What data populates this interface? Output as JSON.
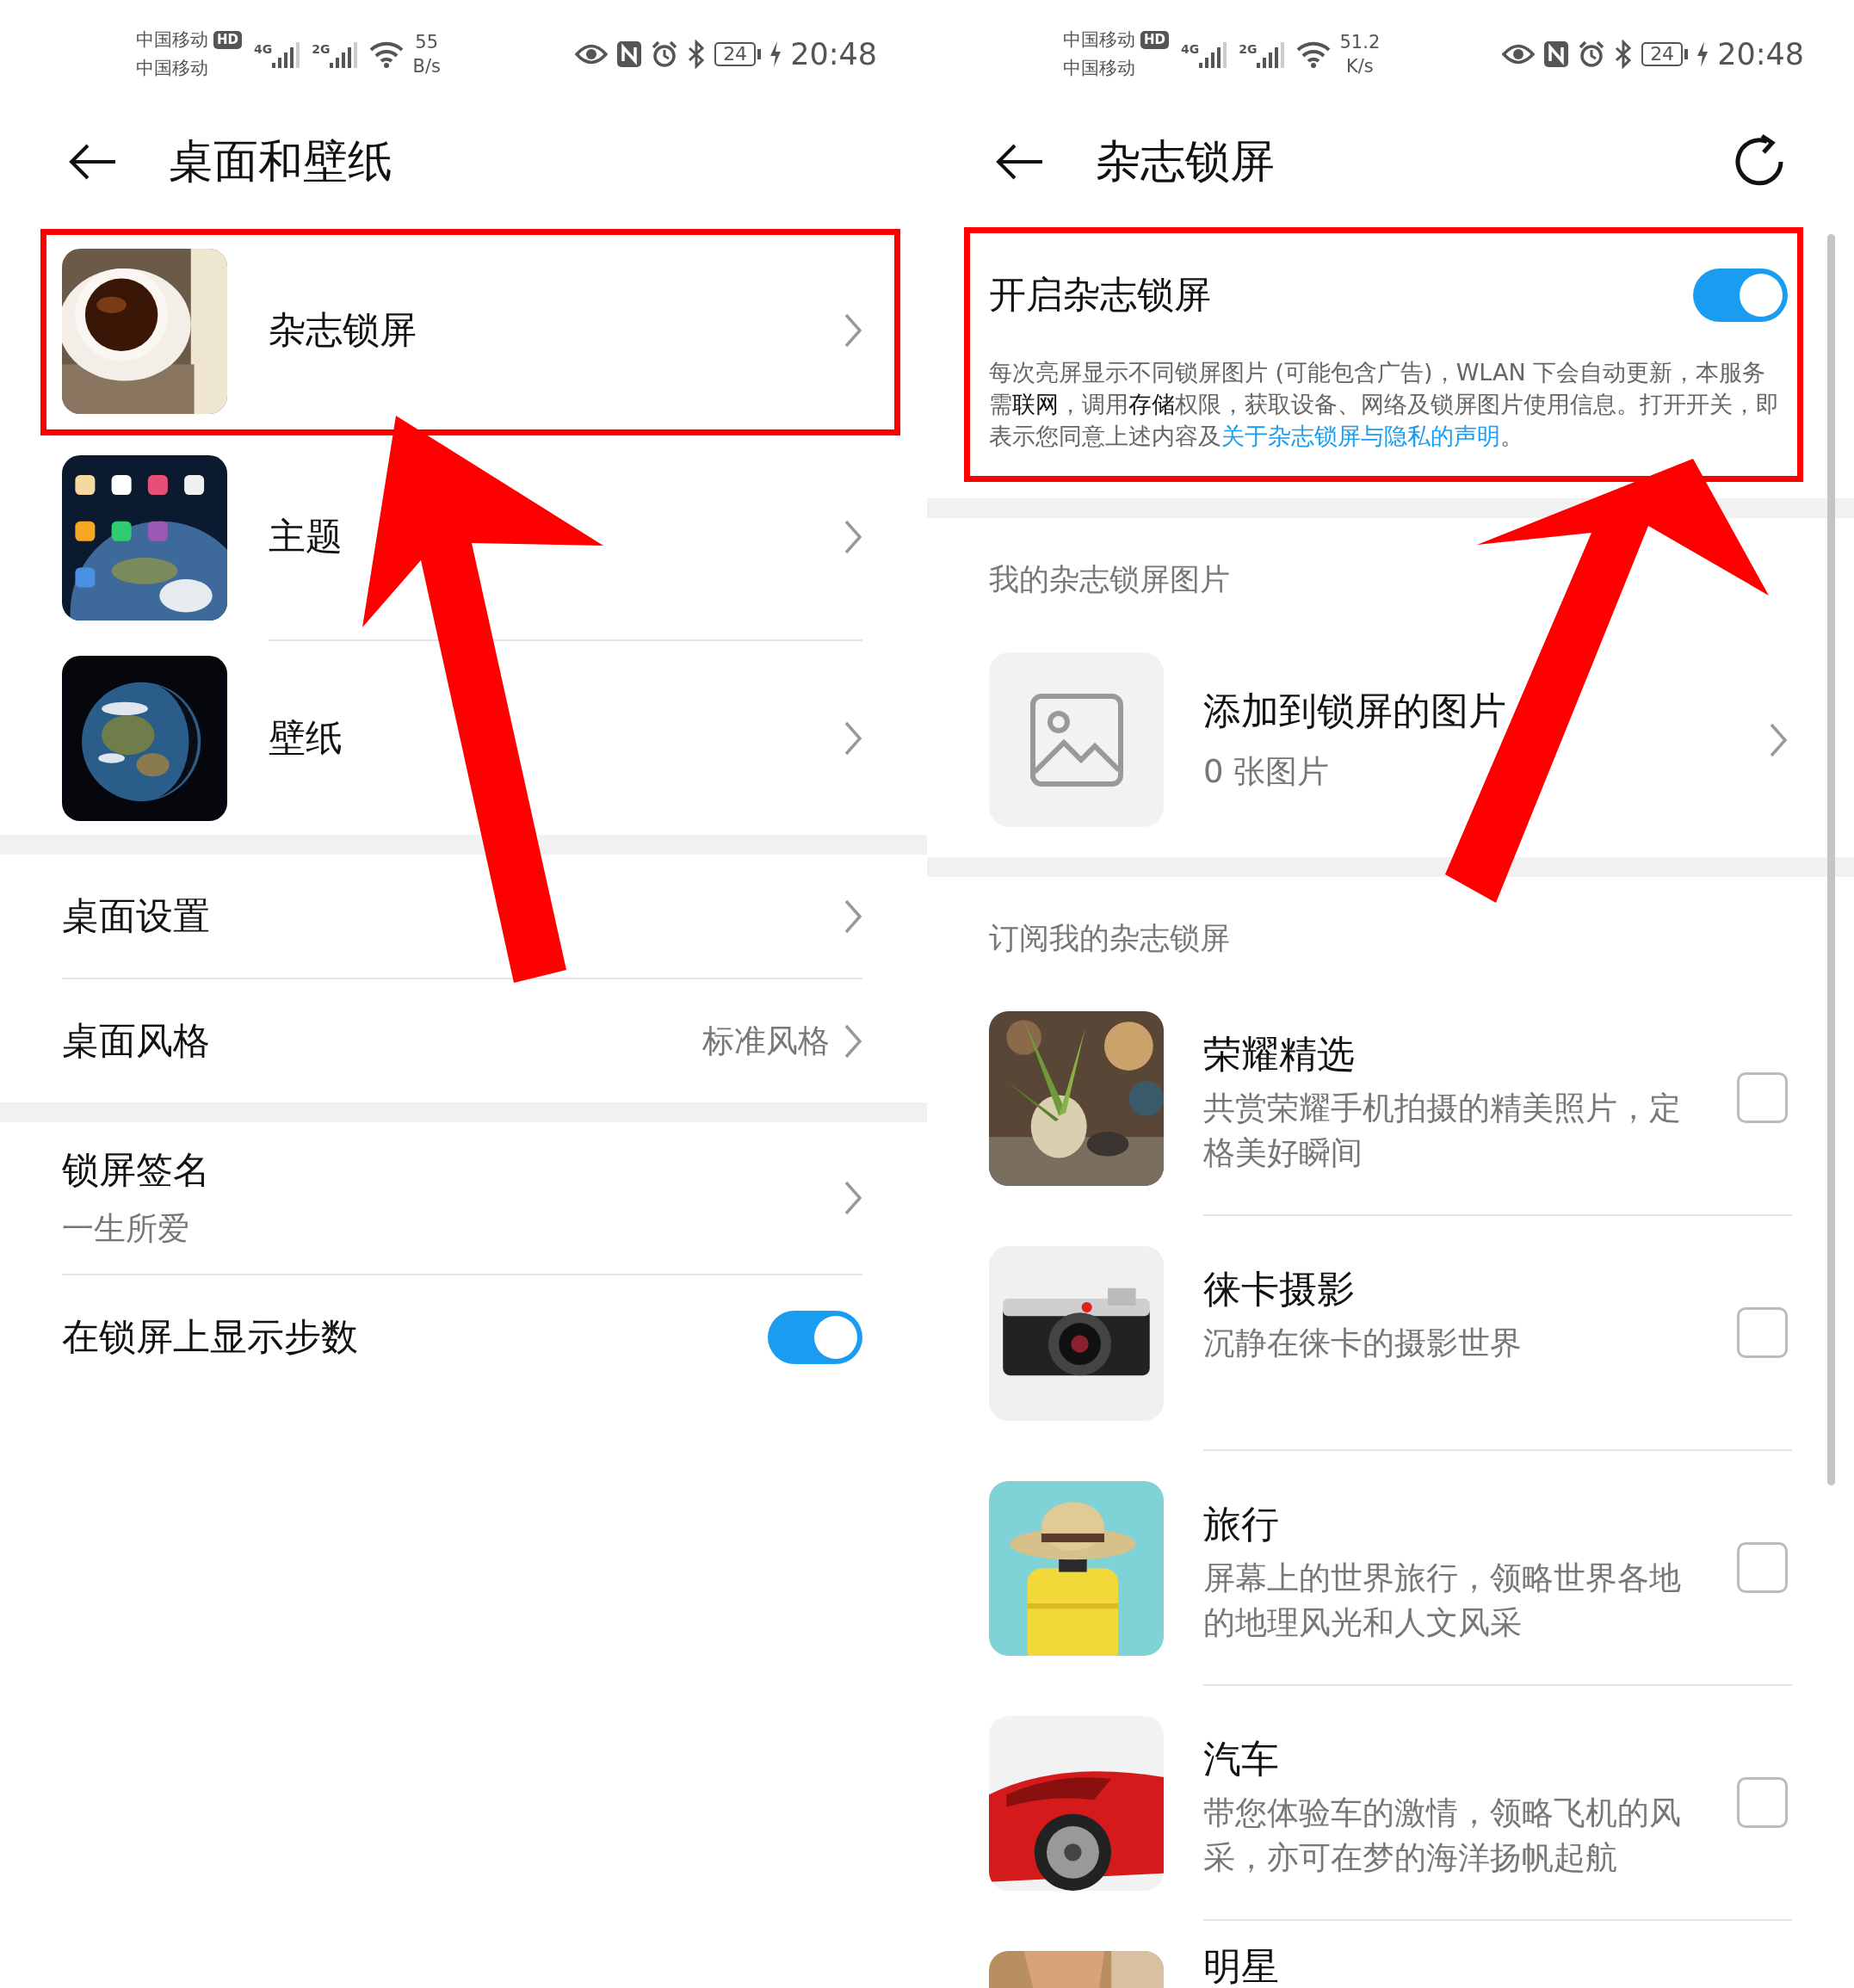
{
  "left_screen": {
    "status_bar": {
      "carriers": [
        "中国移动",
        "中国移动"
      ],
      "hd_badge": "HD",
      "networks": [
        "4G",
        "2G"
      ],
      "speed_value": "55",
      "speed_unit": "B/s",
      "battery": "24",
      "time": "20:48"
    },
    "title": "桌面和壁纸",
    "picture_items": [
      {
        "label": "杂志锁屏",
        "highlighted": true
      },
      {
        "label": "主题",
        "highlighted": false
      },
      {
        "label": "壁纸",
        "highlighted": false
      }
    ],
    "groups": [
      [
        {
          "kind": "nav",
          "label": "桌面设置"
        },
        {
          "kind": "nav",
          "label": "桌面风格",
          "value": "标准风格"
        }
      ],
      [
        {
          "kind": "nav",
          "label": "锁屏签名",
          "subtitle": "一生所爱"
        },
        {
          "kind": "toggle",
          "label": "在锁屏上显示步数",
          "on": true
        }
      ]
    ]
  },
  "right_screen": {
    "status_bar": {
      "carriers": [
        "中国移动",
        "中国移动"
      ],
      "hd_badge": "HD",
      "networks": [
        "4G",
        "2G"
      ],
      "speed_value": "51.2",
      "speed_unit": "K/s",
      "battery": "24",
      "time": "20:48"
    },
    "title": "杂志锁屏",
    "master": {
      "label": "开启杂志锁屏",
      "on": true,
      "highlighted": true,
      "description": "每次亮屏显示不同锁屏图片 (可能包含广告)，WLAN 下会自动更新，本服务需**联网**，调用**存储**权限，获取设备、网络及锁屏图片使用信息。打开开关，即表示您同意上述内容及",
      "link": "关于杂志锁屏与隐私的声明",
      "description_end": "。"
    },
    "my_pictures": {
      "heading": "我的杂志锁屏图片",
      "title": "添加到锁屏的图片",
      "count": "0 张图片"
    },
    "subscriptions": {
      "heading": "订阅我的杂志锁屏",
      "items": [
        {
          "title": "荣耀精选",
          "subtitle": "共赏荣耀手机拍摄的精美照片，定格美好瞬间",
          "checked": false
        },
        {
          "title": "徕卡摄影",
          "subtitle": "沉静在徕卡的摄影世界",
          "checked": false
        },
        {
          "title": "旅行",
          "subtitle": "屏幕上的世界旅行，领略世界各地的地理风光和人文风采",
          "checked": false
        },
        {
          "title": "汽车",
          "subtitle": "带您体验车的激情，领略飞机的风采，亦可在梦的海洋扬帆起航",
          "checked": false
        },
        {
          "title": "明星"
        }
      ]
    }
  }
}
